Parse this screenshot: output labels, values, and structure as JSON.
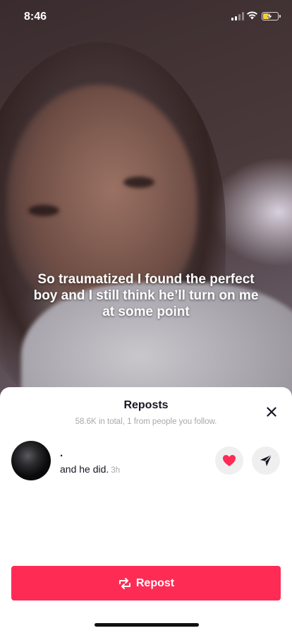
{
  "status_bar": {
    "time": "8:46",
    "battery_color": "#f5d23a"
  },
  "video": {
    "caption": "So traumatized I found the perfect boy and I still think he’ll turn on me at some point"
  },
  "sheet": {
    "title": "Reposts",
    "subtitle": "58.6K in total, 1 from people you follow.",
    "close_icon": "close-icon",
    "items": [
      {
        "username": ".",
        "text": "and he did.",
        "time": "3h",
        "like_icon": "heart-icon",
        "like_color": "#fe2c55",
        "send_icon": "send-icon"
      }
    ],
    "repost_label": "Repost",
    "repost_icon": "repost-icon",
    "accent_color": "#fe2c55"
  }
}
